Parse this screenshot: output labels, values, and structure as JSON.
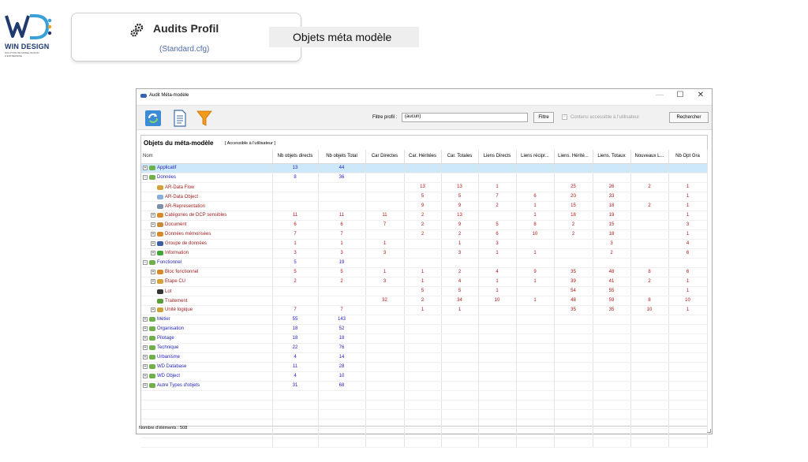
{
  "brand": {
    "name": "WIN DESIGN",
    "tagline": "SOLUTION DE MODELISATION D'ENTREPRISE"
  },
  "header": {
    "title": "Audits Profil",
    "subtitle": "(Standard.cfg)",
    "badge": "Objets méta modèle"
  },
  "window": {
    "title": "Audit Méta-modèle",
    "controls": {
      "minimize": "—",
      "maximize": "☐",
      "close": "✕"
    }
  },
  "toolbar": {
    "filter_label": "Filtre profil :",
    "filter_value": "(aucun)",
    "filter_button": "Filtre",
    "check_label": "Contenu accessible à l'utilisateur",
    "check_mark": "✓",
    "search_button": "Rechercher"
  },
  "section": {
    "title": "Objets du méta-modèle",
    "subtitle": "[ Accessible à l'utilisateur ]"
  },
  "columns": [
    "Nom",
    "Nb objets directs",
    "Nb objets Total",
    "Car Directes",
    "Car. Héritées",
    "Car. Totales",
    "Liens Directs",
    "Liens récipr...",
    "Liens. Hérité...",
    "Liens. Totaux",
    "Nouveaux L...",
    "Nb Opt Gra"
  ],
  "rows": [
    {
      "level": 0,
      "exp": "+",
      "icon": "folder-group",
      "color": "blue",
      "name": "Applicatif",
      "v": [
        "13",
        "44",
        "",
        "",
        "",
        "",
        "",
        "",
        "",
        "",
        ""
      ],
      "sel": true
    },
    {
      "level": 0,
      "exp": "−",
      "icon": "folder-group",
      "color": "blue",
      "name": "Données",
      "v": [
        "8",
        "36",
        "",
        "",
        "",
        "",
        "",
        "",
        "",
        "",
        ""
      ]
    },
    {
      "level": 1,
      "exp": "",
      "icon": "flow",
      "color": "red",
      "name": "AR-Data Flow",
      "v": [
        "",
        "",
        "",
        "13",
        "13",
        "1",
        "",
        "25",
        "26",
        "2",
        "1"
      ]
    },
    {
      "level": 1,
      "exp": "",
      "icon": "page",
      "color": "red",
      "name": "AR-Data Object",
      "v": [
        "",
        "",
        "",
        "5",
        "5",
        "7",
        "6",
        "20",
        "33",
        "",
        "1"
      ]
    },
    {
      "level": 1,
      "exp": "",
      "icon": "list",
      "color": "red",
      "name": "AR-Representation",
      "v": [
        "",
        "",
        "",
        "9",
        "9",
        "2",
        "1",
        "15",
        "18",
        "2",
        "1"
      ]
    },
    {
      "level": 1,
      "exp": "+",
      "icon": "group",
      "color": "red",
      "name": "Catégories de DCP sensibles",
      "v": [
        "11",
        "11",
        "11",
        "2",
        "13",
        "",
        "1",
        "18",
        "19",
        "",
        "1"
      ]
    },
    {
      "level": 1,
      "exp": "+",
      "icon": "doc",
      "color": "red",
      "name": "Document",
      "v": [
        "6",
        "6",
        "7",
        "2",
        "9",
        "5",
        "8",
        "2",
        "15",
        "",
        "3"
      ]
    },
    {
      "level": 1,
      "exp": "+",
      "icon": "group",
      "color": "red",
      "name": "Données mémorisées",
      "v": [
        "7",
        "7",
        "",
        "2",
        "2",
        "6",
        "10",
        "2",
        "18",
        "",
        "1"
      ]
    },
    {
      "level": 1,
      "exp": "+",
      "icon": "brace",
      "color": "red",
      "name": "Groupe de données",
      "v": [
        "1",
        "1",
        "1",
        "",
        "1",
        "3",
        "",
        "",
        "3",
        "",
        "4"
      ]
    },
    {
      "level": 1,
      "exp": "+",
      "icon": "dot",
      "color": "red",
      "name": "Information",
      "v": [
        "3",
        "3",
        "3",
        "",
        "3",
        "1",
        "1",
        "",
        "2",
        "",
        "6"
      ]
    },
    {
      "level": 0,
      "exp": "−",
      "icon": "folder-group",
      "color": "blue",
      "name": "Fonctionnel",
      "v": [
        "5",
        "19",
        "",
        "",
        "",
        "",
        "",
        "",
        "",
        "",
        ""
      ]
    },
    {
      "level": 1,
      "exp": "+",
      "icon": "group",
      "color": "red",
      "name": "Bloc fonctionnel",
      "v": [
        "5",
        "5",
        "1",
        "1",
        "2",
        "4",
        "9",
        "35",
        "48",
        "8",
        "6"
      ]
    },
    {
      "level": 1,
      "exp": "+",
      "icon": "flow",
      "color": "red",
      "name": "Etape CU",
      "v": [
        "2",
        "2",
        "3",
        "1",
        "4",
        "1",
        "1",
        "39",
        "41",
        "2",
        "1"
      ]
    },
    {
      "level": 1,
      "exp": "",
      "icon": "lot",
      "color": "red",
      "name": "Lot",
      "v": [
        "",
        "",
        "",
        "5",
        "5",
        "1",
        "",
        "54",
        "55",
        "",
        "1"
      ]
    },
    {
      "level": 1,
      "exp": "",
      "icon": "gear",
      "color": "red",
      "name": "Traitement",
      "v": [
        "",
        "",
        "32",
        "2",
        "34",
        "10",
        "1",
        "48",
        "59",
        "8",
        "10"
      ]
    },
    {
      "level": 1,
      "exp": "+",
      "icon": "box",
      "color": "red",
      "name": "Unité logique",
      "v": [
        "7",
        "7",
        "",
        "1",
        "1",
        "",
        "",
        "35",
        "35",
        "10",
        "1"
      ]
    },
    {
      "level": 0,
      "exp": "+",
      "icon": "folder-group",
      "color": "blue",
      "name": "Métier",
      "v": [
        "55",
        "143",
        "",
        "",
        "",
        "",
        "",
        "",
        "",
        "",
        ""
      ]
    },
    {
      "level": 0,
      "exp": "+",
      "icon": "folder-group",
      "color": "blue",
      "name": "Organisation",
      "v": [
        "18",
        "52",
        "",
        "",
        "",
        "",
        "",
        "",
        "",
        "",
        ""
      ]
    },
    {
      "level": 0,
      "exp": "+",
      "icon": "folder-group",
      "color": "blue",
      "name": "Pilotage",
      "v": [
        "18",
        "18",
        "",
        "",
        "",
        "",
        "",
        "",
        "",
        "",
        ""
      ]
    },
    {
      "level": 0,
      "exp": "+",
      "icon": "folder-group",
      "color": "blue",
      "name": "Technique",
      "v": [
        "22",
        "76",
        "",
        "",
        "",
        "",
        "",
        "",
        "",
        "",
        ""
      ]
    },
    {
      "level": 0,
      "exp": "+",
      "icon": "folder-group",
      "color": "blue",
      "name": "Urbanisme",
      "v": [
        "4",
        "14",
        "",
        "",
        "",
        "",
        "",
        "",
        "",
        "",
        ""
      ]
    },
    {
      "level": 0,
      "exp": "+",
      "icon": "folder-group",
      "color": "blue",
      "name": "WD Database",
      "v": [
        "11",
        "28",
        "",
        "",
        "",
        "",
        "",
        "",
        "",
        "",
        ""
      ]
    },
    {
      "level": 0,
      "exp": "+",
      "icon": "folder-group",
      "color": "blue",
      "name": "WD Object",
      "v": [
        "4",
        "10",
        "",
        "",
        "",
        "",
        "",
        "",
        "",
        "",
        ""
      ]
    },
    {
      "level": 0,
      "exp": "+",
      "icon": "folder-group",
      "color": "blue",
      "name": "Autre Types d'objets",
      "v": [
        "31",
        "68",
        "",
        "",
        "",
        "",
        "",
        "",
        "",
        "",
        ""
      ]
    }
  ],
  "status": {
    "label": "Nombre d'éléments :",
    "count": "508"
  },
  "colors": {
    "blue_text": "#2323c9",
    "red_text": "#b01515",
    "selection": "#cde8f8"
  }
}
